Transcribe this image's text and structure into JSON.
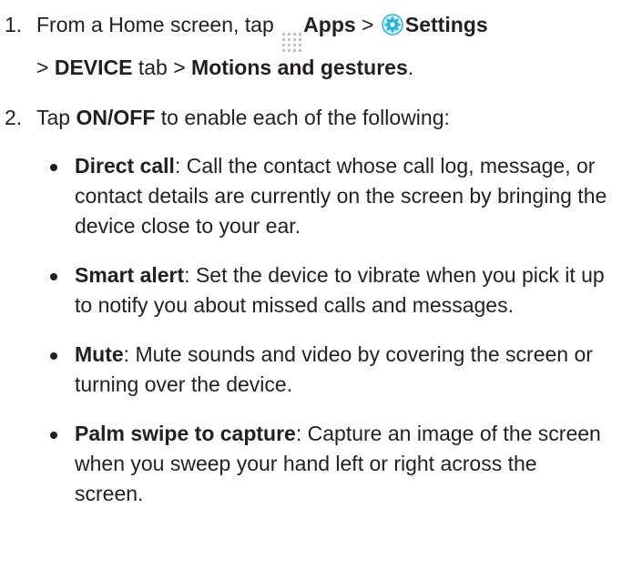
{
  "steps": [
    {
      "number": "1.",
      "prefix": "From a Home screen, tap",
      "apps_icon": "apps-grid-icon",
      "apps_label": "Apps",
      "sep1": ">",
      "settings_icon": "settings-gear-icon",
      "settings_label": "Settings",
      "sep2": ">",
      "device_label": "DEVICE",
      "tab_text": "tab >",
      "motions_label": "Motions and gestures",
      "period": "."
    },
    {
      "number": "2.",
      "prefix": "Tap",
      "onoff_label": "ON/OFF",
      "suffix": "to enable each of the following:"
    }
  ],
  "bullets": [
    {
      "term": "Direct call",
      "text": ": Call the contact whose call log, message, or contact details are currently on the screen by bringing the device close to your ear."
    },
    {
      "term": "Smart alert",
      "text": ": Set the device to vibrate when you pick it up to notify you about missed calls and messages."
    },
    {
      "term": "Mute",
      "text": ": Mute sounds and video by covering the screen or turning over the device."
    },
    {
      "term": "Palm swipe to capture",
      "text": ": Capture an image of the screen when you sweep your hand left or right across the screen."
    }
  ],
  "colors": {
    "text": "#231f20",
    "apps_icon": "#bfc3c7",
    "settings_icon": "#2ab4d8"
  }
}
